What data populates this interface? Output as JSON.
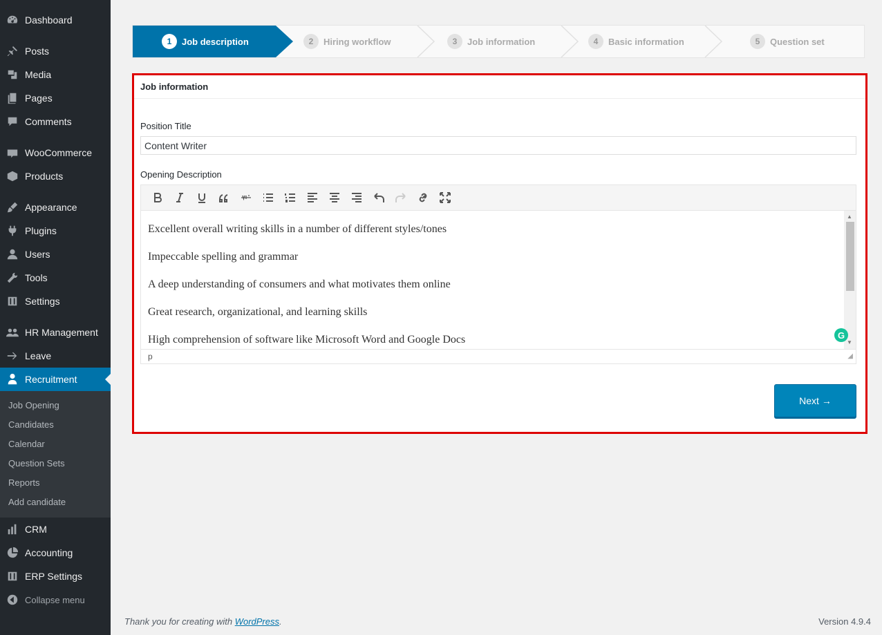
{
  "sidebar": {
    "items": [
      {
        "label": "Dashboard",
        "icon": "dashboard-icon"
      },
      {
        "label": "Posts",
        "icon": "pin-icon"
      },
      {
        "label": "Media",
        "icon": "media-icon"
      },
      {
        "label": "Pages",
        "icon": "pages-icon"
      },
      {
        "label": "Comments",
        "icon": "comment-icon"
      },
      {
        "label": "WooCommerce",
        "icon": "woocommerce-icon"
      },
      {
        "label": "Products",
        "icon": "box-icon"
      },
      {
        "label": "Appearance",
        "icon": "brush-icon"
      },
      {
        "label": "Plugins",
        "icon": "plug-icon"
      },
      {
        "label": "Users",
        "icon": "user-icon"
      },
      {
        "label": "Tools",
        "icon": "wrench-icon"
      },
      {
        "label": "Settings",
        "icon": "sliders-icon"
      },
      {
        "label": "HR Management",
        "icon": "group-icon"
      },
      {
        "label": "Leave",
        "icon": "arrow-right-icon"
      },
      {
        "label": "Recruitment",
        "icon": "recruit-icon"
      },
      {
        "label": "CRM",
        "icon": "bar-chart-icon"
      },
      {
        "label": "Accounting",
        "icon": "pie-chart-icon"
      },
      {
        "label": "ERP Settings",
        "icon": "sliders-icon"
      },
      {
        "label": "Collapse menu",
        "icon": "collapse-icon"
      }
    ],
    "submenu": [
      "Job Opening",
      "Candidates",
      "Calendar",
      "Question Sets",
      "Reports",
      "Add candidate"
    ]
  },
  "stepper": {
    "steps": [
      {
        "num": "1",
        "label": "Job description"
      },
      {
        "num": "2",
        "label": "Hiring workflow"
      },
      {
        "num": "3",
        "label": "Job information"
      },
      {
        "num": "4",
        "label": "Basic information"
      },
      {
        "num": "5",
        "label": "Question set"
      }
    ]
  },
  "panel": {
    "title": "Job information",
    "position_label": "Position Title",
    "position_value": "Content Writer",
    "description_label": "Opening Description",
    "paragraphs": [
      "Excellent overall writing skills in a number of different styles/tones",
      "Impeccable spelling and grammar",
      "A deep understanding of consumers and what motivates them online",
      "Great research, organizational, and learning skills",
      "High comprehension of software like Microsoft Word and Google Docs"
    ],
    "status_path": "p",
    "grammarly": "G",
    "next_label": "Next →"
  },
  "footer": {
    "thanks_prefix": "Thank you for creating with ",
    "thanks_link": "WordPress",
    "thanks_suffix": ".",
    "version": "Version 4.9.4"
  },
  "colors": {
    "sidebar_bg": "#23282d",
    "accent": "#0073aa",
    "highlight_border": "#dd0000",
    "primary_button": "#0085ba"
  }
}
